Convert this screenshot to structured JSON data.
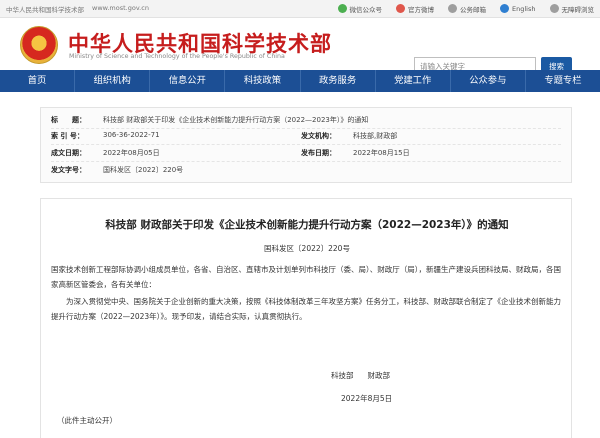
{
  "topbar": {
    "site_name": "中华人民共和国科学技术部",
    "url": "www.most.gov.cn",
    "links": [
      "微信公众号",
      "官方微博",
      "公务邮箱",
      "English",
      "无障碍浏览"
    ]
  },
  "header": {
    "title": "中华人民共和国科学技术部",
    "subtitle": "Ministry of Science and Technology of the People's Republic of China",
    "search_placeholder": "请输入关键字",
    "search_button": "搜索"
  },
  "nav": [
    "首页",
    "组织机构",
    "信息公开",
    "科技政策",
    "政务服务",
    "党建工作",
    "公众参与",
    "专题专栏"
  ],
  "meta": {
    "title_label": "标　　题：",
    "title_value": "科技部 财政部关于印发《企业技术创新能力提升行动方案（2022—2023年）》的通知",
    "index_label": "索 引 号：",
    "index_value": "306-36-2022-71",
    "issuer_label": "发文机构：",
    "issuer_value": "科技部,财政部",
    "created_label": "成文日期：",
    "created_value": "2022年08月05日",
    "published_label": "发布日期：",
    "published_value": "2022年08月15日",
    "docno_label": "发文字号：",
    "docno_value": "国科发区〔2022〕220号"
  },
  "article": {
    "title": "科技部 财政部关于印发《企业技术创新能力提升行动方案（2022—2023年）》的通知",
    "doc_no": "国科发区〔2022〕220号",
    "para1": "国家技术创新工程部际协调小组成员单位，各省、自治区、直辖市及计划单列市科技厅（委、局）、财政厅（局），新疆生产建设兵团科技局、财政局，各国家高新区管委会，各有关单位：",
    "para2": "为深入贯彻党中央、国务院关于企业创新的重大决策，按照《科技体制改革三年攻坚方案》任务分工，科技部、财政部联合制定了《企业技术创新能力提升行动方案（2022—2023年）》。现予印发，请结合实际，认真贯彻执行。",
    "sign1": "科技部",
    "sign2": "财政部",
    "date": "2022年8月5日",
    "public_note": "（此件主动公开）"
  }
}
